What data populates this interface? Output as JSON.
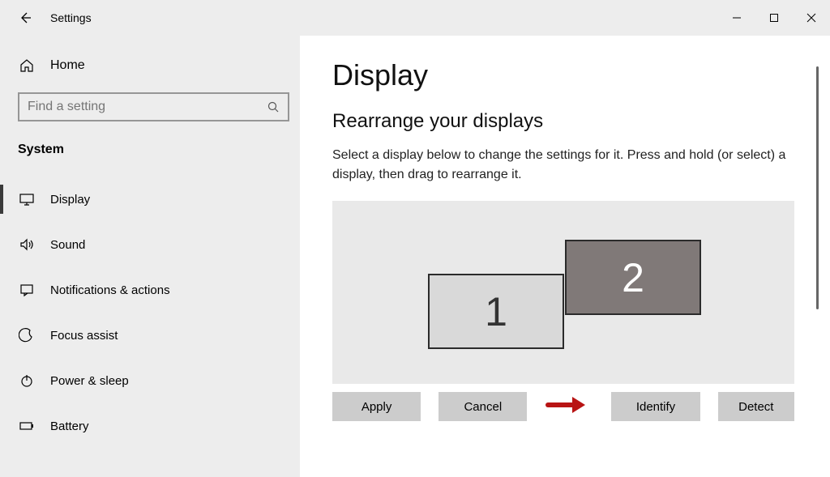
{
  "window": {
    "title": "Settings"
  },
  "sidebar": {
    "home": "Home",
    "search_placeholder": "Find a setting",
    "section": "System",
    "items": [
      {
        "label": "Display"
      },
      {
        "label": "Sound"
      },
      {
        "label": "Notifications & actions"
      },
      {
        "label": "Focus assist"
      },
      {
        "label": "Power & sleep"
      },
      {
        "label": "Battery"
      }
    ]
  },
  "content": {
    "heading": "Display",
    "subheading": "Rearrange your displays",
    "description": "Select a display below to change the settings for it. Press and hold (or select) a display, then drag to rearrange it.",
    "monitors": {
      "m1": "1",
      "m2": "2"
    },
    "buttons": {
      "apply": "Apply",
      "cancel": "Cancel",
      "identify": "Identify",
      "detect": "Detect"
    }
  }
}
